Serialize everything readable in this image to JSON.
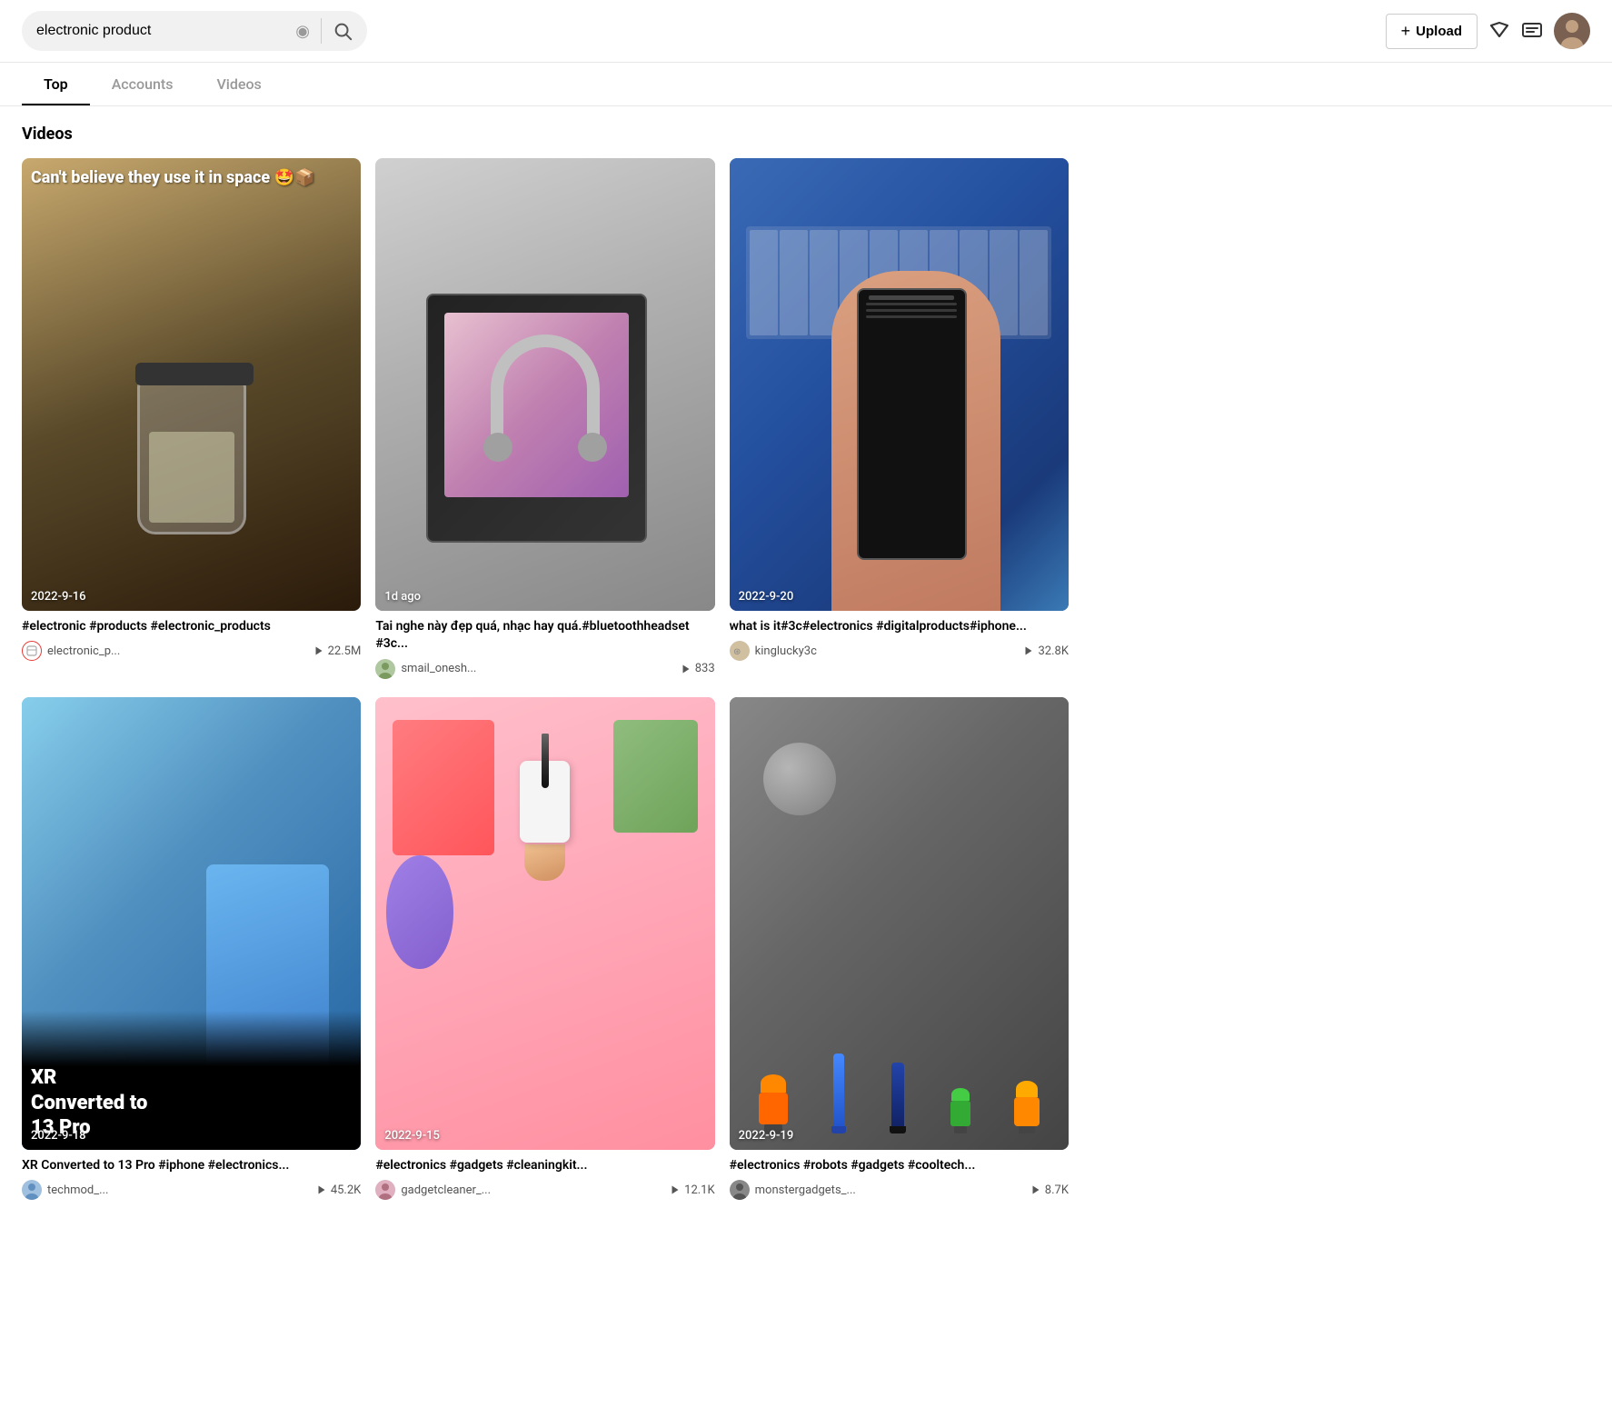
{
  "header": {
    "search_placeholder": "electronic product",
    "search_value": "electronic product",
    "upload_label": "Upload",
    "clear_button": "×"
  },
  "tabs": [
    {
      "id": "top",
      "label": "Top",
      "active": true
    },
    {
      "id": "accounts",
      "label": "Accounts",
      "active": false
    },
    {
      "id": "videos",
      "label": "Videos",
      "active": false
    }
  ],
  "section": {
    "title": "Videos"
  },
  "videos": [
    {
      "id": 1,
      "title": "#electronic #products #electronic_products",
      "author": "electronic_p...",
      "views": "22.5M",
      "timestamp": "2022-9-16",
      "thumb_type": "jar",
      "thumb_text": "Can't believe they use it in space 🤩📦",
      "has_ring_avatar": true
    },
    {
      "id": 2,
      "title": "Tai nghe này đẹp quá, nhạc hay quá.#bluetoothheadset #3c...",
      "author": "smail_onesh...",
      "views": "833",
      "timestamp": "1d ago",
      "thumb_type": "headphones",
      "thumb_text": "",
      "has_ring_avatar": false
    },
    {
      "id": 3,
      "title": "what is it#3c#electronics #digitalproducts#iphone...",
      "author": "kinglucky3c",
      "views": "32.8K",
      "timestamp": "2022-9-20",
      "thumb_type": "phone_blue",
      "thumb_text": "",
      "has_ring_avatar": false
    },
    {
      "id": 4,
      "title": "XR Converted to 13 Pro",
      "author": "techmod_...",
      "views": "45.2K",
      "timestamp": "2022-9-18",
      "thumb_type": "xr",
      "thumb_text": "XR\nConverted to\n13 Pro",
      "has_ring_avatar": false
    },
    {
      "id": 5,
      "title": "#electronics #gadgets #cleaningkit...",
      "author": "gadgetcleaner_...",
      "views": "12.1K",
      "timestamp": "2022-9-15",
      "thumb_type": "pen",
      "thumb_text": "",
      "has_ring_avatar": false
    },
    {
      "id": 6,
      "title": "#electronics #robots #gadgets #cooltech...",
      "author": "monstergadgets_...",
      "views": "8.7K",
      "timestamp": "2022-9-19",
      "thumb_type": "robots",
      "thumb_text": "",
      "has_ring_avatar": false
    }
  ]
}
